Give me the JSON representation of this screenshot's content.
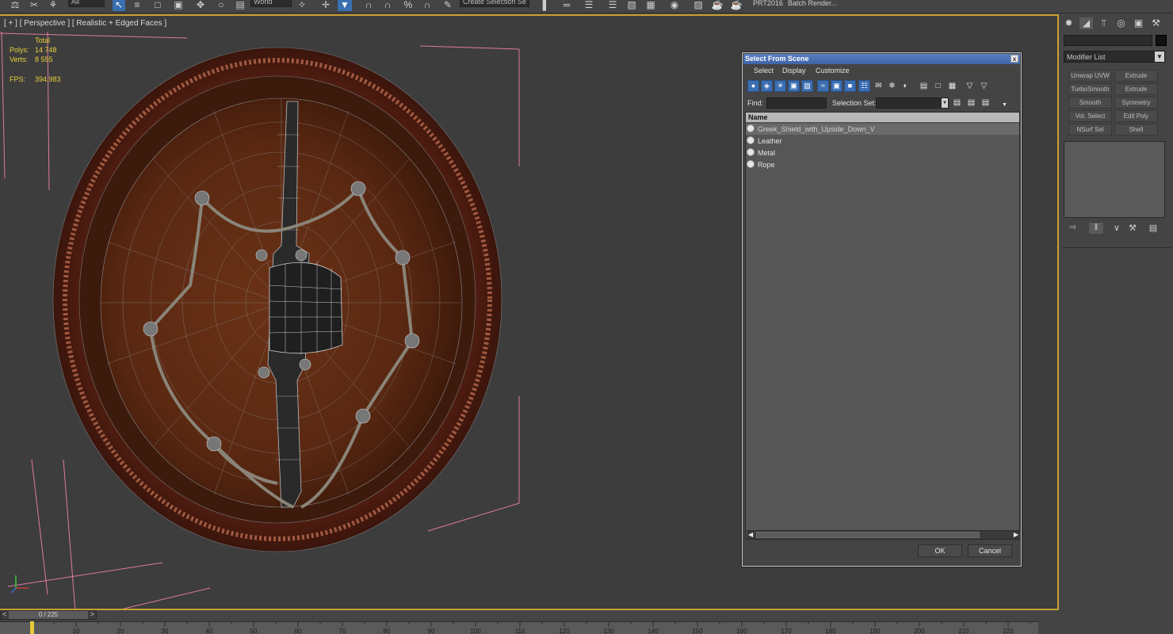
{
  "toolbar": {
    "coord_system": "World",
    "selection_set_placeholder": "Create Selection Se",
    "prt_label": "PRT2016",
    "batch_render_label": "Batch Render..."
  },
  "viewport": {
    "label": "[ + ] [ Perspective ] [ Realistic + Edged Faces ]",
    "stats": {
      "total_label": "Total",
      "polys_label": "Polys:",
      "polys_value": "14 748",
      "verts_label": "Verts:",
      "verts_value": "8 555",
      "fps_label": "FPS:",
      "fps_value": "394,983"
    },
    "accent_color": "#c8a032",
    "bbox_color": "#e07aa0"
  },
  "command_panel": {
    "modifier_list_label": "Modifier List",
    "modifier_buttons": [
      "Unwrap UVW",
      "Extrude",
      "TurboSmooth",
      "Extrude",
      "Smooth",
      "Symmetry",
      "Vol. Select",
      "Edit Poly",
      "NSurf Sel",
      "Shell"
    ]
  },
  "dialog": {
    "title": "Select From Scene",
    "close_label": "x",
    "menu": [
      "Select",
      "Display",
      "Customize"
    ],
    "find_label": "Find:",
    "selection_set_label": "Selection Set:",
    "column_header": "Name",
    "items": [
      "Greek_Shield_with_Upside_Down_V",
      "Leather",
      "Metal",
      "Rope"
    ],
    "ok_label": "OK",
    "cancel_label": "Cancel"
  },
  "timeline": {
    "frame_label": "0 / 225",
    "prev_label": "<",
    "next_label": ">",
    "ticks": [
      "10",
      "20",
      "30",
      "40",
      "50",
      "60",
      "70",
      "80",
      "90",
      "100",
      "110",
      "120",
      "130",
      "140",
      "150",
      "160",
      "170",
      "180",
      "190",
      "200",
      "210",
      "220"
    ],
    "marker_color": "#e7c93a"
  }
}
